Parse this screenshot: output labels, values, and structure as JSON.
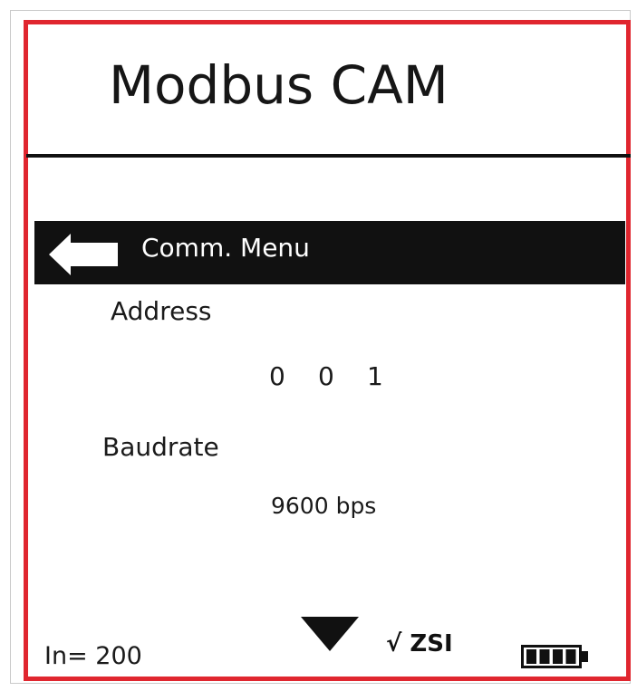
{
  "header": {
    "title": "Modbus CAM"
  },
  "menu": {
    "label": "Comm. Menu",
    "back_icon": "back-arrow-icon"
  },
  "settings": {
    "address": {
      "label": "Address",
      "digits": [
        "0",
        "0",
        "1"
      ]
    },
    "baudrate": {
      "label": "Baudrate",
      "value": "9600 bps"
    }
  },
  "footer": {
    "in_readout": "In= 200",
    "zsi_label": "√ ZSI",
    "scroll_icon": "down-triangle-icon",
    "battery_icon": "battery-icon",
    "battery_level": 1.0
  },
  "colors": {
    "frame": "#e0262f",
    "bar": "#111111",
    "bar_text": "#ffffff"
  }
}
